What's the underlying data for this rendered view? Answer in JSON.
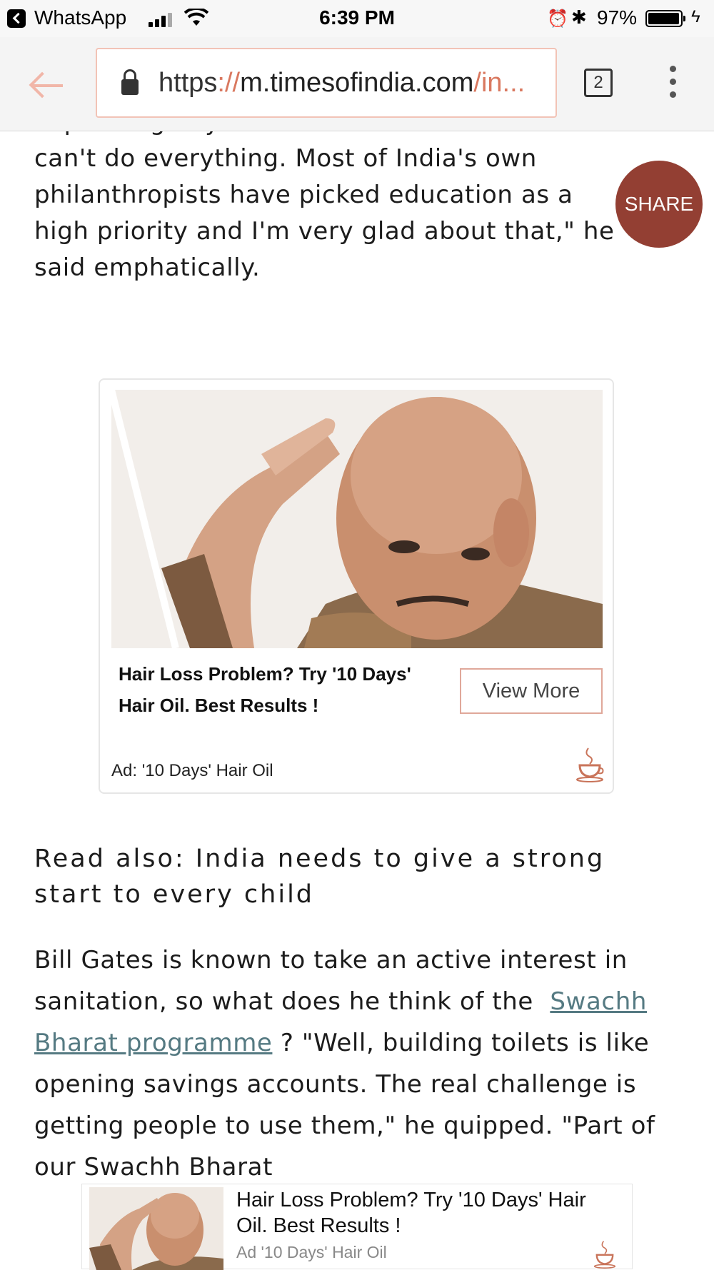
{
  "status_bar": {
    "back_app": "WhatsApp",
    "time": "6:39 PM",
    "battery": "97%",
    "battery_level": 0.97
  },
  "browser": {
    "url_scheme": "https",
    "url_sep": "://",
    "url_host": "m.timesofindia.com",
    "url_path": "/in...",
    "tab_count": "2",
    "accent_color": "#d9785f"
  },
  "article": {
    "para1_lines": [
      "expanding beyond health into education? \"We",
      "can't do everything. Most of India's own",
      "philanthropists have picked education as a",
      "high priority and I'm very glad about that,\" he",
      "said emphatically."
    ],
    "read_also": "Read also: India needs to give a strong start to every child",
    "para2_before": "Bill Gates is known to take an active interest in sanitation, so what does he think of the",
    "para2_link": "Swachh Bharat programme",
    "para2_after": " ? \"Well, building toilets is like opening savings accounts. The real challenge is getting people to use them,\" he quipped. \"Part of our Swachh Bharat"
  },
  "share": {
    "label": "SHARE",
    "color": "#933f33"
  },
  "ad": {
    "title": "Hair Loss Problem? Try '10 Days' Hair Oil. Best Results !",
    "button": "View More",
    "sponsor": "Ad: '10 Days' Hair Oil"
  },
  "bottom_ad": {
    "title": "Hair Loss Problem? Try '10 Days' Hair Oil. Best Results !",
    "sponsor": "Ad '10 Days' Hair Oil"
  }
}
